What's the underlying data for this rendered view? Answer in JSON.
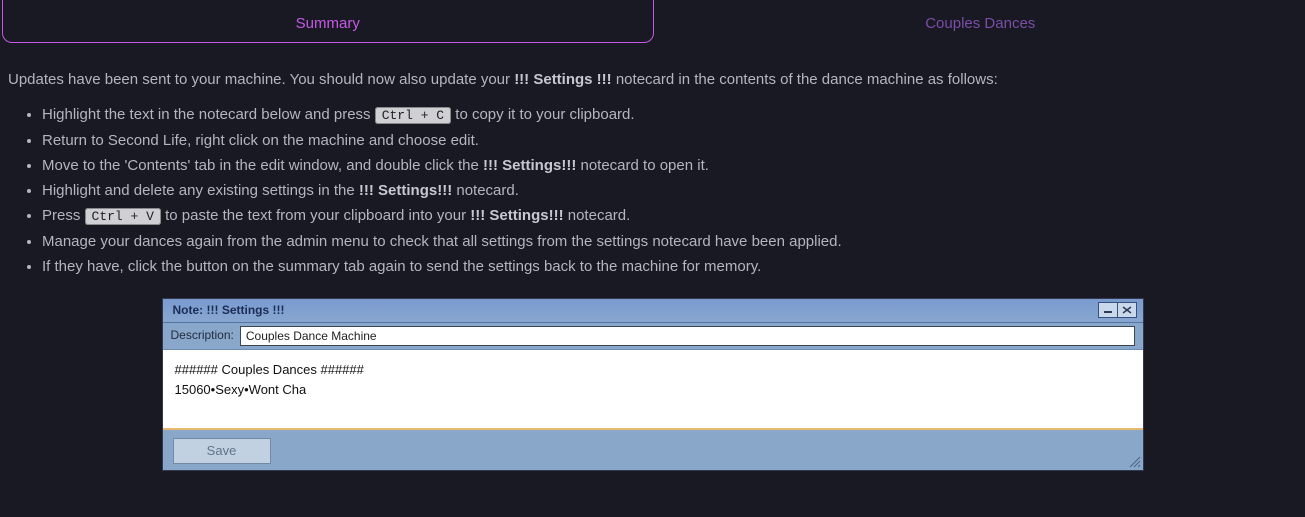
{
  "tabs": {
    "summary": "Summary",
    "couples": "Couples Dances"
  },
  "intro": {
    "prefix": "Updates have been sent to your machine. You should now also update your ",
    "bold": "!!! Settings !!!",
    "suffix": " notecard in the contents of the dance machine as follows:"
  },
  "steps": {
    "s1a": "Highlight the text in the notecard below and press ",
    "s1kbd": "Ctrl + C",
    "s1b": " to copy it to your clipboard.",
    "s2": "Return to Second Life, right click on the machine and choose edit.",
    "s3a": "Move to the 'Contents' tab in the edit window, and double click the ",
    "s3bold": "!!! Settings!!!",
    "s3b": " notecard to open it.",
    "s4a": "Highlight and delete any existing settings in the ",
    "s4bold": "!!! Settings!!!",
    "s4b": " notecard.",
    "s5a": "Press ",
    "s5kbd": "Ctrl + V",
    "s5b": " to paste the text from your clipboard into your ",
    "s5bold": "!!! Settings!!!",
    "s5c": " notecard.",
    "s6": "Manage your dances again from the admin menu to check that all settings from the settings notecard have been applied.",
    "s7": "If they have, click the button on the summary tab again to send the settings back to the machine for memory."
  },
  "notecard": {
    "title": "Note: !!! Settings !!!",
    "desc_label": "Description:",
    "desc_value": "Couples Dance Machine",
    "body": "###### Couples Dances ######\n15060•Sexy•Wont Cha",
    "save": "Save"
  }
}
